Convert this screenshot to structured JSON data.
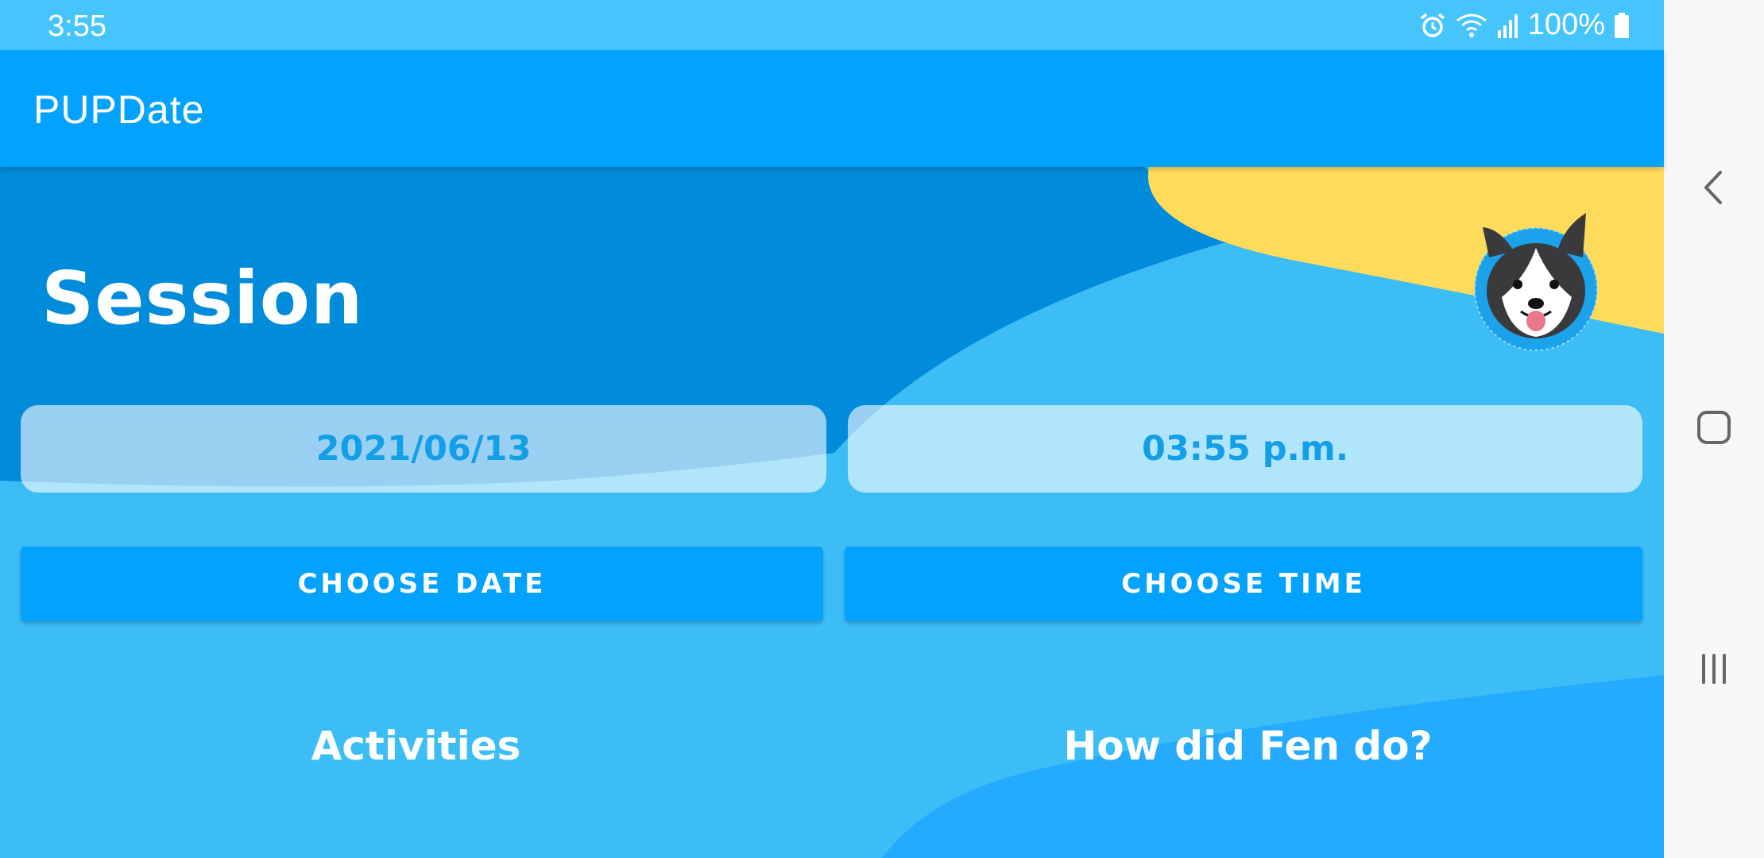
{
  "status_bar": {
    "time": "3:55",
    "battery": "100%",
    "icons": [
      "alarm-icon",
      "wifi-icon",
      "signal-icon",
      "battery-icon"
    ]
  },
  "app_bar": {
    "title": "PUPDate"
  },
  "session": {
    "heading": "Session",
    "date_value": "2021/06/13",
    "time_value": "03:55 p.m.",
    "choose_date_label": "CHOOSE DATE",
    "choose_time_label": "CHOOSE TIME",
    "activities_heading": "Activities",
    "how_heading": "How did Fen do?"
  },
  "nav_bar": {
    "icons": [
      "back-icon",
      "home-icon",
      "recents-icon"
    ]
  },
  "colors": {
    "status_bar": "#46c5fd",
    "app_bar": "#03a2fe",
    "content_bg": "#3cbdf6",
    "dark_wave": "#018bdb",
    "yellow_wave": "#fedb5a",
    "button": "#03a2fe",
    "value_text": "#129fe8"
  }
}
